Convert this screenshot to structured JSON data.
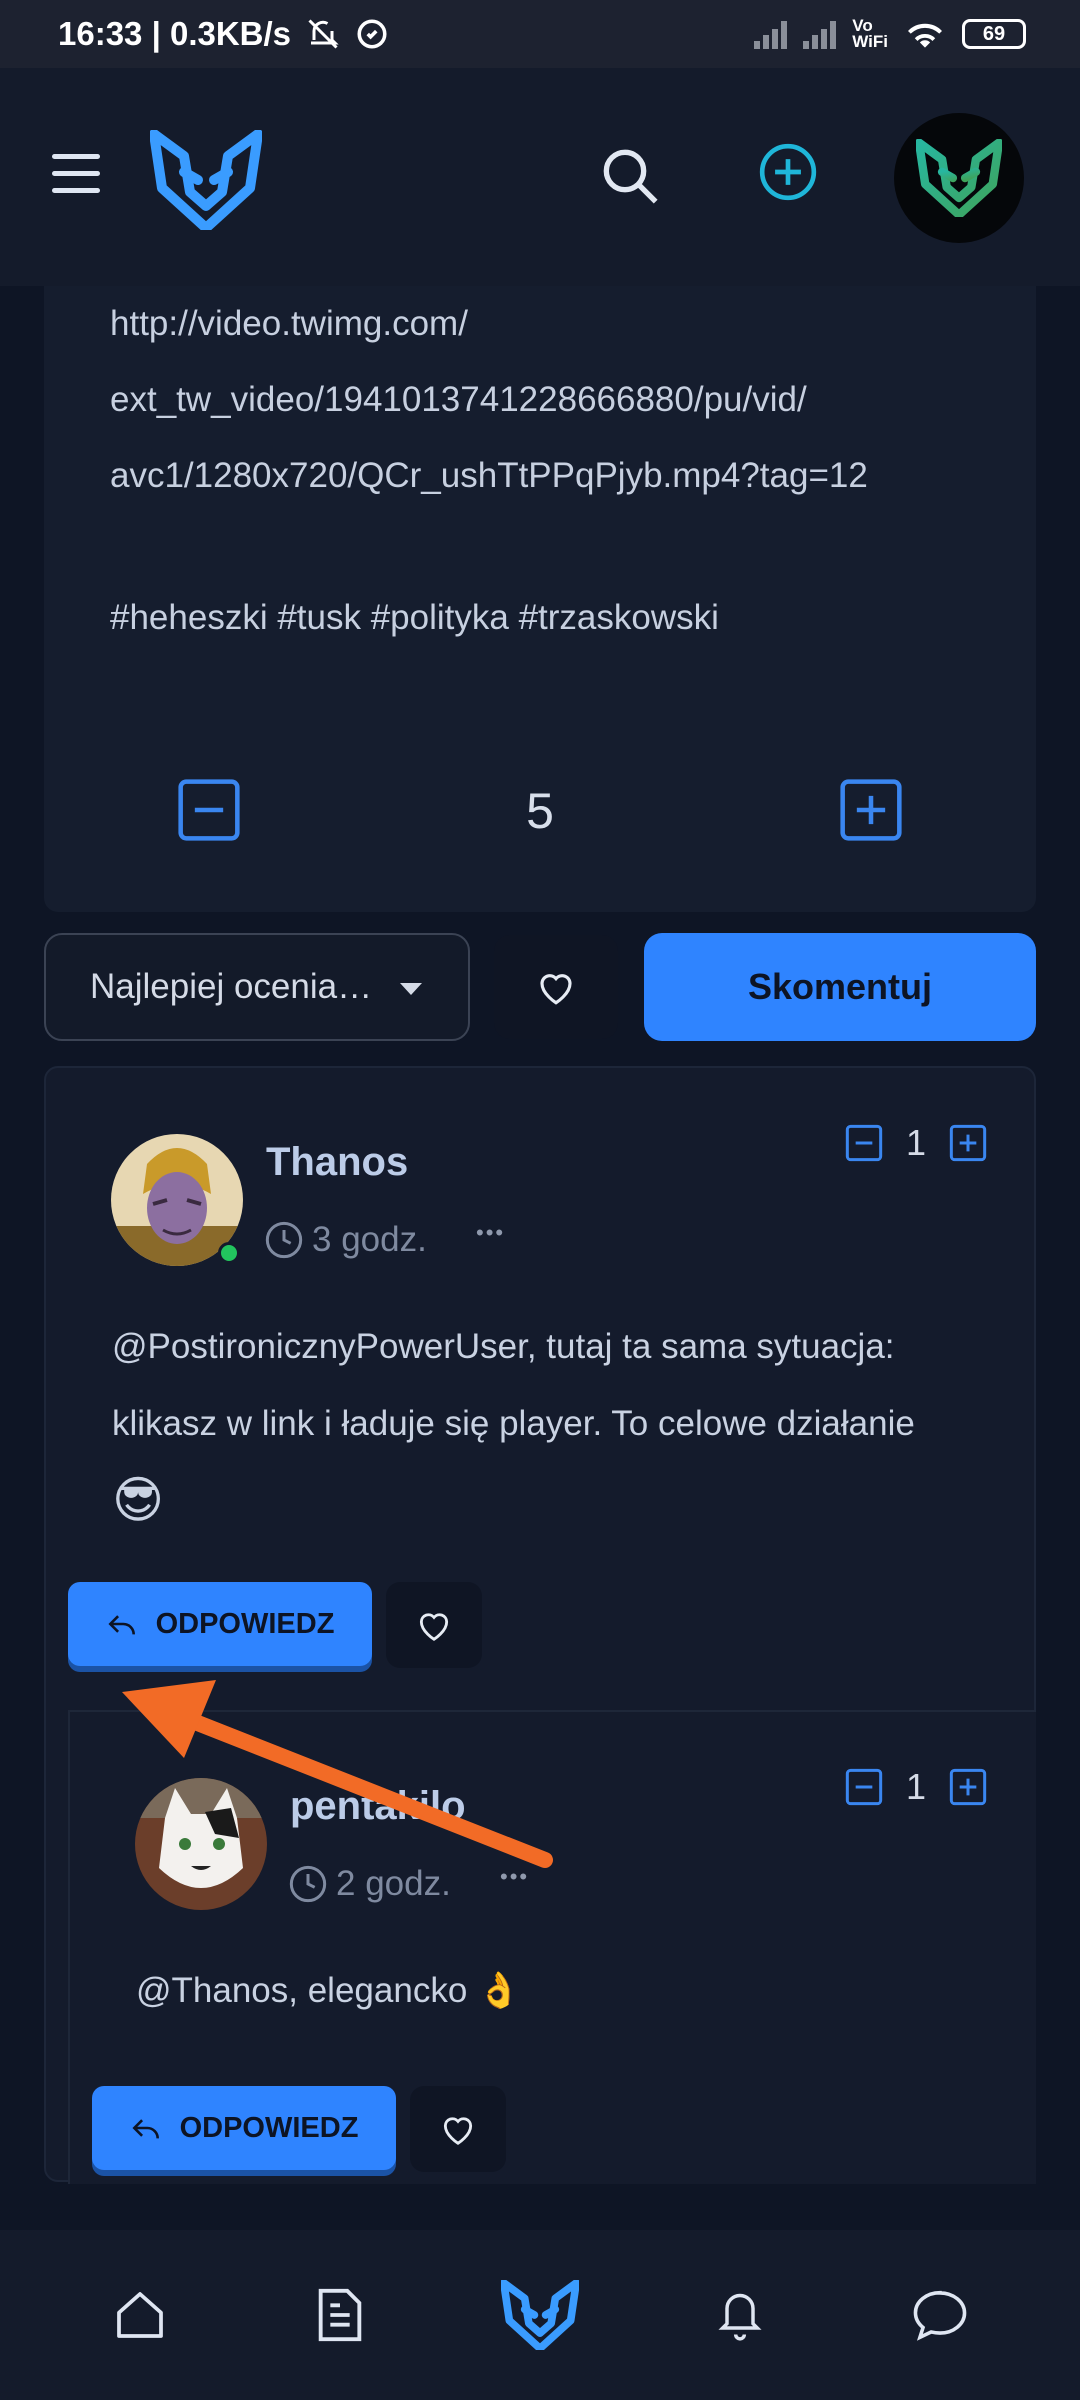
{
  "status_bar": {
    "time_speed": "16:33 | 0.3KB/s",
    "vowifi": "Vo\nWiFi",
    "battery": "69"
  },
  "header": {
    "menu_icon": "hamburger-icon",
    "logo_icon": "wolf-logo-icon",
    "search_icon": "search-icon",
    "add_icon": "plus-circle-icon"
  },
  "post": {
    "text_lines": [
      "http://video.twimg.com/",
      "ext_tw_video/1941013741228666880/pu/vid/",
      "avc1/1280x720/QCr_ushTtPPqPjyb.mp4?tag=12"
    ],
    "tags": "#heheszki #tusk #polityka #trzaskowski",
    "vote_count": "5"
  },
  "actions": {
    "sort_label": "Najlepiej ocenia…",
    "comment_button": "Skomentuj"
  },
  "comments": [
    {
      "author": "Thanos",
      "time": "3 godz.",
      "more": "•••",
      "votes": "1",
      "text_lines": [
        "@PostironicznyPowerUser, tutaj ta sama sytuacja:",
        "klikasz w link i ładuje się player. To celowe działanie"
      ],
      "emoji": "😎",
      "reply_label": "ODPOWIEDZ"
    },
    {
      "author": "pentakilo",
      "time": "2 godz.",
      "more": "•••",
      "votes": "1",
      "text": "@Thanos, elegancko 👌",
      "reply_label": "ODPOWIEDZ"
    }
  ],
  "bottom_nav": [
    "home-icon",
    "document-icon",
    "wolf-logo-icon",
    "bell-icon",
    "chat-icon"
  ],
  "colors": {
    "accent": "#2f84ff",
    "background": "#0e1525",
    "card": "#151d2e",
    "annotation_arrow": "#f26b26"
  }
}
